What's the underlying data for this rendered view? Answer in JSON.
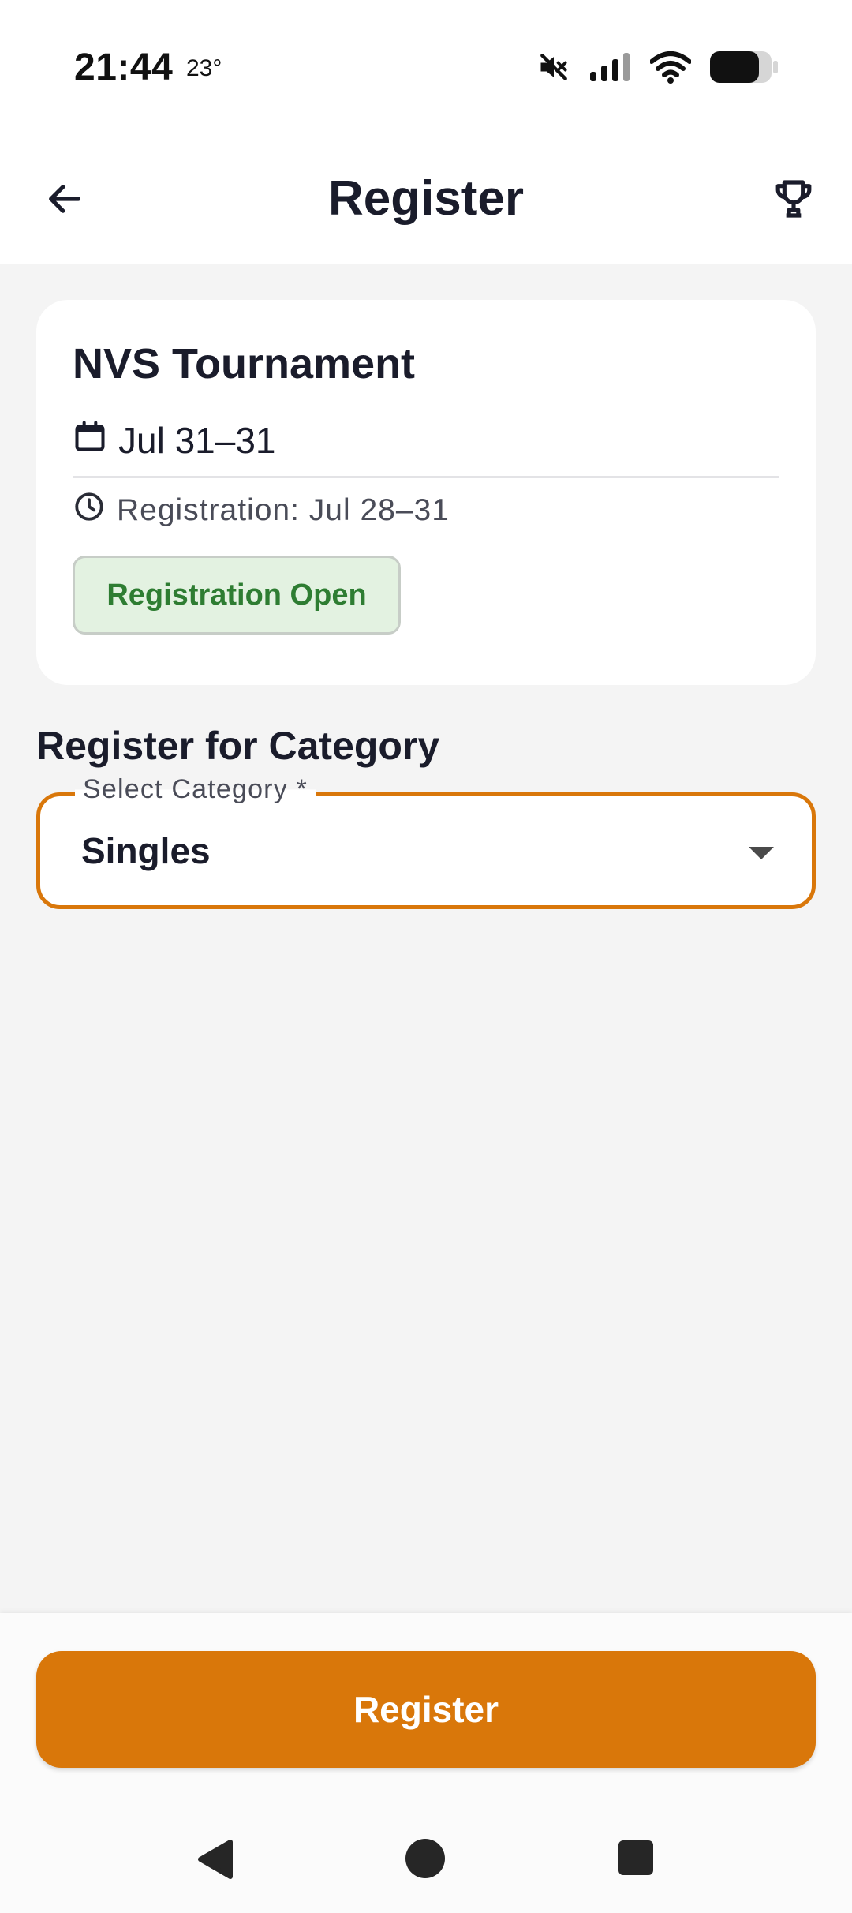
{
  "status_bar": {
    "time": "21:44",
    "temperature": "23°",
    "icons": [
      "mute-icon",
      "signal-icon",
      "wifi-icon",
      "battery-icon"
    ]
  },
  "app_bar": {
    "title": "Register",
    "back_icon": "arrow-left-icon",
    "action_icon": "trophy-icon"
  },
  "tournament": {
    "name": "NVS Tournament",
    "dates": "Jul 31–31",
    "registration": "Registration: Jul 28–31",
    "status": "Registration Open"
  },
  "category": {
    "heading": "Register for Category",
    "select_label": "Select Category *",
    "selected_value": "Singles"
  },
  "actions": {
    "register_label": "Register"
  },
  "colors": {
    "accent": "#d9770a",
    "status_green": "#2e7d32",
    "status_green_bg": "#e3f2e1",
    "background": "#f4f4f4"
  }
}
